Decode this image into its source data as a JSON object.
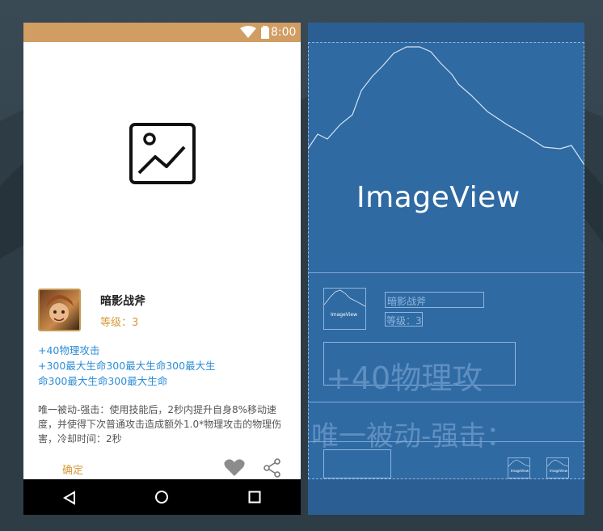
{
  "status_bar": {
    "time": "8:00",
    "color": "#d09d62"
  },
  "hero": {
    "name": "暗影战斧",
    "level": "等级：3"
  },
  "stats": {
    "line1": "+40物理攻击",
    "line2": "+300最大生命300最大生命300最大生",
    "line3": "命300最大生命300最大生命"
  },
  "passive": {
    "text": "唯一被动-强击：使用技能后，2秒内提升自身8%移动速度，并使得下次普通攻击造成额外1.0*物理攻击的物理伤害，冷却时间：2秒"
  },
  "actions": {
    "confirm_label": "确定",
    "icons": [
      "heart-icon",
      "share-icon"
    ]
  },
  "nav_bar": {
    "icons": [
      "back-icon",
      "home-icon",
      "recent-apps-icon"
    ]
  },
  "blueprint": {
    "image_label": "ImageView",
    "thumb_label": "ImageView",
    "name_outline": "暗影战斧",
    "level_outline": "等级：3",
    "stats_outline": "+40物理攻",
    "passive_outline": "唯一被动-强击：",
    "mini_label_1": "ImageView",
    "mini_label_2": "ImageView"
  },
  "colors": {
    "accent": "#d69a3a",
    "stats_blue": "#2d8ed6",
    "blueprint_bg": "#2f6aa3"
  }
}
